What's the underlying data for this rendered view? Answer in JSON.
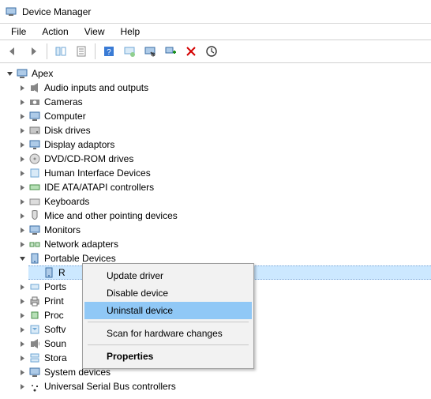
{
  "window": {
    "title": "Device Manager"
  },
  "menu": {
    "items": [
      "File",
      "Action",
      "View",
      "Help"
    ]
  },
  "toolbar": {
    "icons": [
      "back-icon",
      "forward-icon",
      "show-hidden-icon",
      "properties-icon",
      "help-icon",
      "action-center-icon",
      "scan-hardware-icon",
      "add-legacy-icon",
      "remove-icon",
      "update-driver-icon"
    ]
  },
  "tree": {
    "root": {
      "label": "Apex",
      "expanded": true
    },
    "items": [
      {
        "label": "Audio inputs and outputs",
        "icon": "audio-icon"
      },
      {
        "label": "Cameras",
        "icon": "camera-icon"
      },
      {
        "label": "Computer",
        "icon": "computer-icon"
      },
      {
        "label": "Disk drives",
        "icon": "disk-icon"
      },
      {
        "label": "Display adaptors",
        "icon": "display-icon"
      },
      {
        "label": "DVD/CD-ROM drives",
        "icon": "dvd-icon"
      },
      {
        "label": "Human Interface Devices",
        "icon": "hid-icon"
      },
      {
        "label": "IDE ATA/ATAPI controllers",
        "icon": "ide-icon"
      },
      {
        "label": "Keyboards",
        "icon": "keyboard-icon"
      },
      {
        "label": "Mice and other pointing devices",
        "icon": "mouse-icon"
      },
      {
        "label": "Monitors",
        "icon": "monitor-icon"
      },
      {
        "label": "Network adapters",
        "icon": "network-icon"
      },
      {
        "label": "Portable Devices",
        "icon": "portable-icon",
        "expanded": true,
        "children": [
          {
            "label": "R",
            "icon": "portable-device-icon",
            "selected": true
          }
        ]
      },
      {
        "label": "Ports",
        "icon": "port-icon"
      },
      {
        "label": "Print",
        "icon": "printer-icon"
      },
      {
        "label": "Proc",
        "icon": "processor-icon"
      },
      {
        "label": "Softv",
        "icon": "software-icon"
      },
      {
        "label": "Soun",
        "icon": "sound-icon"
      },
      {
        "label": "Stora",
        "icon": "storage-icon"
      },
      {
        "label": "System devices",
        "icon": "system-icon"
      },
      {
        "label": "Universal Serial Bus controllers",
        "icon": "usb-icon"
      }
    ]
  },
  "context_menu": {
    "items": [
      {
        "label": "Update driver"
      },
      {
        "label": "Disable device"
      },
      {
        "label": "Uninstall device",
        "highlight": true
      },
      {
        "sep": true
      },
      {
        "label": "Scan for hardware changes"
      },
      {
        "sep": true
      },
      {
        "label": "Properties",
        "bold": true
      }
    ]
  }
}
